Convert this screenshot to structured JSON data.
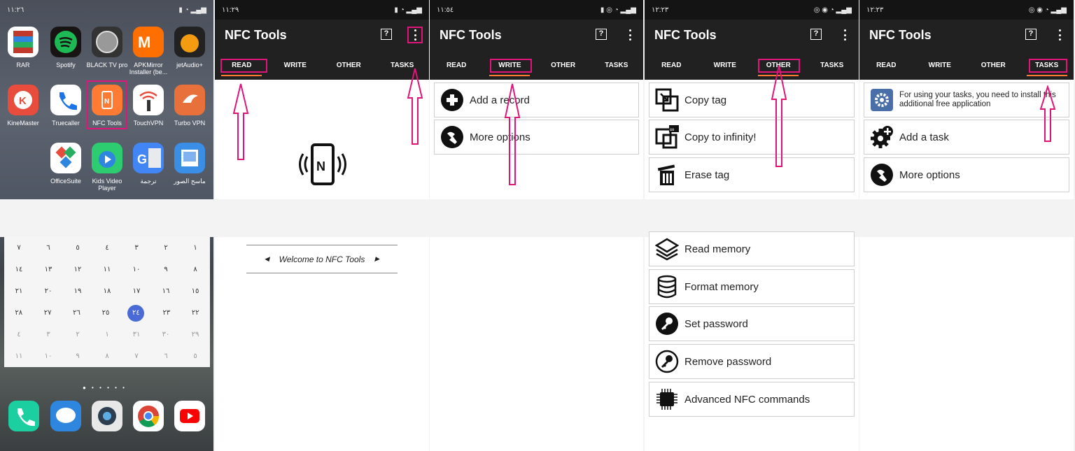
{
  "home": {
    "status_time": "١١:٢٦",
    "apps_row1": [
      "RAR",
      "Spotify",
      "BLACK TV pro",
      "APKMirror Installer (be...",
      "jetAudio+"
    ],
    "apps_row2": [
      "KineMaster",
      "Truecaller",
      "NFC Tools",
      "TouchVPN",
      "Turbo VPN"
    ],
    "apps_row3": [
      "OfficeSuite",
      "Kids Video Player",
      "ترجمة",
      "ماسح الصور"
    ],
    "calendar": [
      [
        "٧",
        "٦",
        "٥",
        "٤",
        "٣",
        "٢",
        "١"
      ],
      [
        "١٤",
        "١٣",
        "١٢",
        "١١",
        "١٠",
        "٩",
        "٨"
      ],
      [
        "٢١",
        "٢٠",
        "١٩",
        "١٨",
        "١٧",
        "١٦",
        "١٥"
      ],
      [
        "٢٨",
        "٢٧",
        "٢٦",
        "٢٥",
        "٢٤",
        "٢٣",
        "٢٢"
      ],
      [
        "٤",
        "٣",
        "٢",
        "١",
        "٣١",
        "٣٠",
        "٢٩"
      ],
      [
        "١١",
        "١٠",
        "٩",
        "٨",
        "٧",
        "٦",
        "٥"
      ]
    ],
    "calendar_today": "٢٤"
  },
  "app": {
    "title": "NFC Tools",
    "help_glyph": "?",
    "tabs": [
      "READ",
      "WRITE",
      "OTHER",
      "TASKS"
    ],
    "accent": "#ff7a33",
    "highlight": "#e0157b"
  },
  "read": {
    "status_time": "١١:٢٩",
    "welcome": "Welcome to NFC Tools"
  },
  "write": {
    "status_time": "١١:٥٤",
    "items": [
      "Add a record",
      "More options"
    ]
  },
  "other": {
    "status_time": "١٢:٢٣",
    "items": [
      "Copy tag",
      "Copy to infinity!",
      "Erase tag",
      "Read memory",
      "Format memory",
      "Set password",
      "Remove password",
      "Advanced NFC commands"
    ]
  },
  "tasks": {
    "status_time": "١٢:٢٣",
    "notice": "For using your tasks, you need to install this additional free application",
    "items": [
      "Add a task",
      "More options"
    ]
  }
}
